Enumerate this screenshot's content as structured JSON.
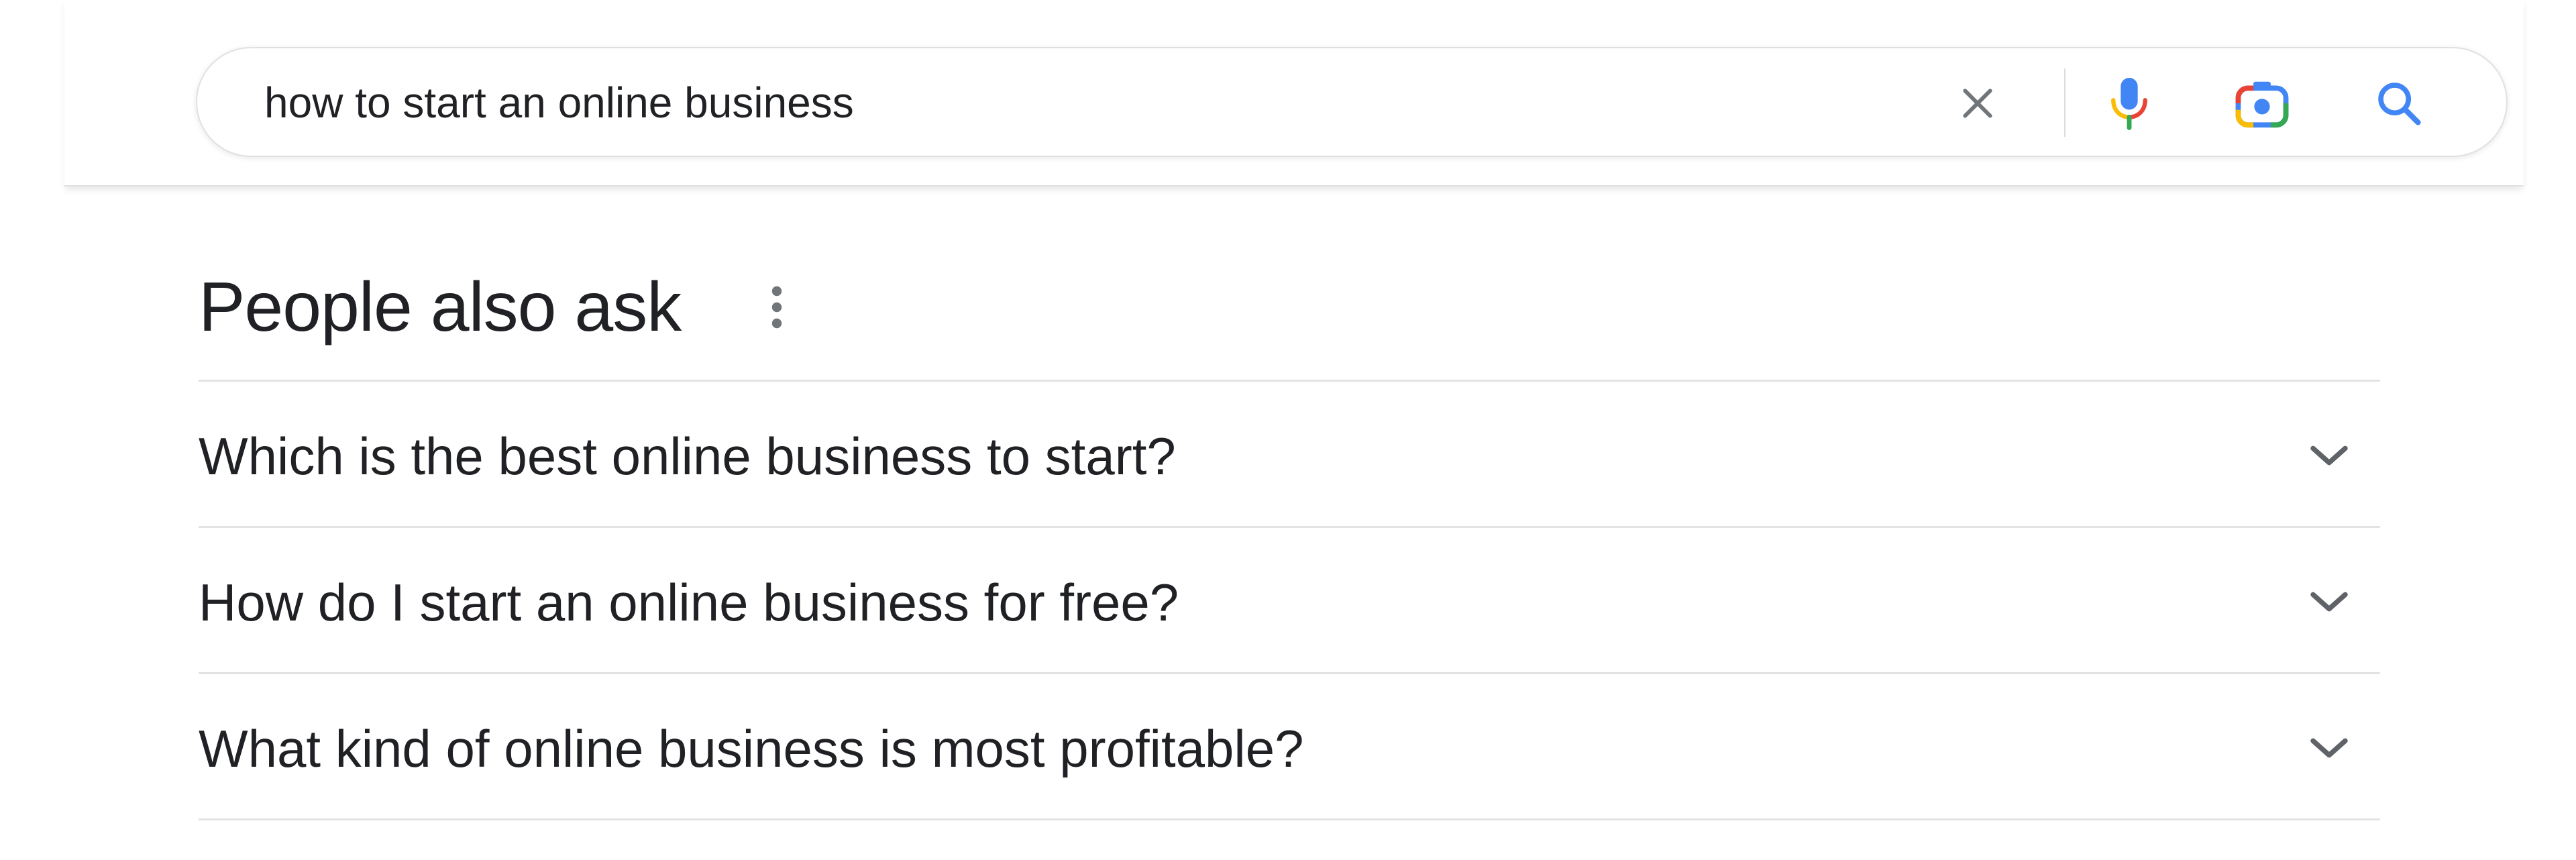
{
  "search": {
    "query": "how to start an online business",
    "clear_icon": "close-icon",
    "voice_icon": "microphone-icon",
    "lens_icon": "camera-lens-icon",
    "search_icon": "search-icon"
  },
  "people_also_ask": {
    "title": "People also ask",
    "menu_icon": "more-vert-icon",
    "questions": [
      {
        "text": "Which is the best online business to start?",
        "icon": "chevron-down-icon"
      },
      {
        "text": "How do I start an online business for free?",
        "icon": "chevron-down-icon"
      },
      {
        "text": "What kind of online business is most profitable?",
        "icon": "chevron-down-icon"
      }
    ]
  },
  "colors": {
    "text": "#202124",
    "icon_gray": "#70757a",
    "divider": "#e3e3e3",
    "google_blue": "#4285f4",
    "google_red": "#ea4335",
    "google_yellow": "#fbbc05",
    "google_green": "#34a853"
  }
}
